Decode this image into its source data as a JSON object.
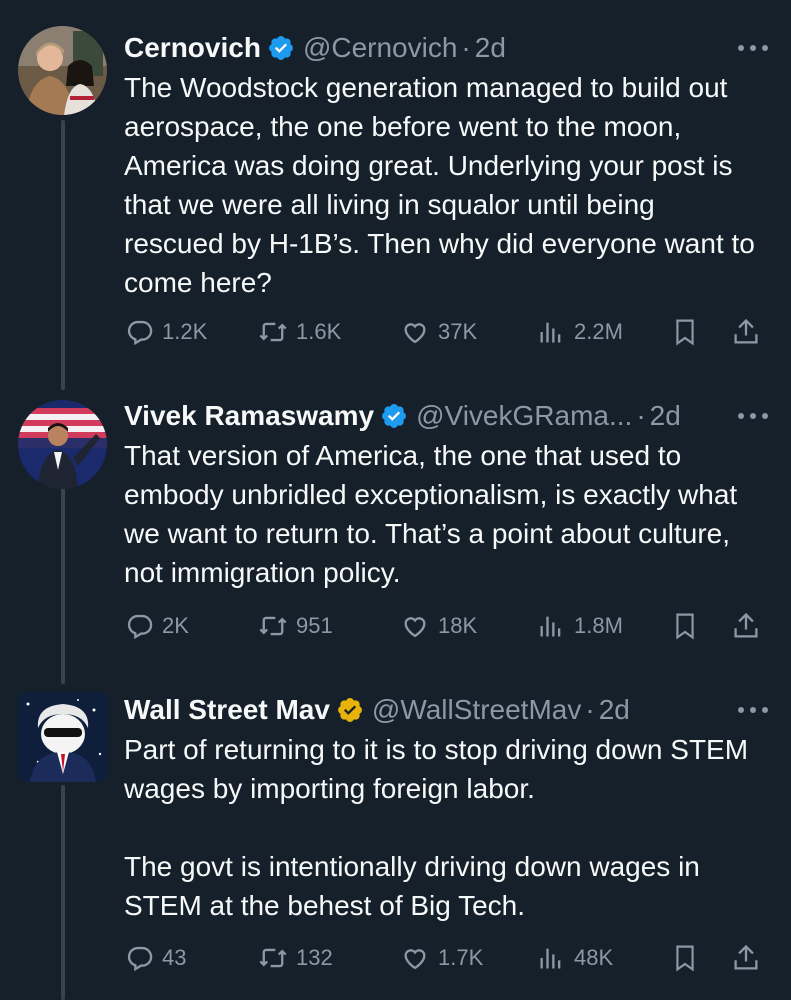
{
  "tweets": [
    {
      "name": "Cernovich",
      "handle": "@Cernovich",
      "time": "2d",
      "badge_color": "#1d9bf0",
      "avatar": "photo-avatar",
      "text": "The Woodstock generation managed to build out aerospace, the one before went to the moon, America was doing great. Underlying your post is that we were all living in squalor until being rescued by H-1B’s. Then why did everyone want to come here?",
      "stats": {
        "replies": "1.2K",
        "reposts": "1.6K",
        "likes": "37K",
        "views": "2.2M"
      }
    },
    {
      "name": "Vivek Ramaswamy",
      "handle": "@VivekGRama...",
      "time": "2d",
      "badge_color": "#1d9bf0",
      "avatar": "photo-avatar",
      "text": "That version of America, the one that used to embody unbridled exceptionalism, is exactly what we want to return to. That’s a point about culture, not immigration policy.",
      "stats": {
        "replies": "2K",
        "reposts": "951",
        "likes": "18K",
        "views": "1.8M"
      }
    },
    {
      "name": "Wall Street Mav",
      "handle": "@WallStreetMav",
      "time": "2d",
      "badge_color": "#e8b20a",
      "avatar": "cartoon-avatar",
      "text": "Part of returning to it is to stop driving down STEM wages by importing foreign labor.\n\nThe govt is intentionally driving down wages in STEM at the behest of Big Tech.",
      "stats": {
        "replies": "43",
        "reposts": "132",
        "likes": "1.7K",
        "views": "48K"
      }
    }
  ],
  "dot_separator": "·",
  "colors": {
    "background": "#15202b",
    "text": "#f7f9f9",
    "muted": "#8b98a5",
    "thread_line": "#38444d",
    "verified_blue": "#1d9bf0",
    "verified_gold": "#e8b20a"
  },
  "icons": [
    "reply-icon",
    "repost-icon",
    "like-icon",
    "views-icon",
    "bookmark-icon",
    "share-icon",
    "more-icon",
    "verified-badge-icon"
  ]
}
